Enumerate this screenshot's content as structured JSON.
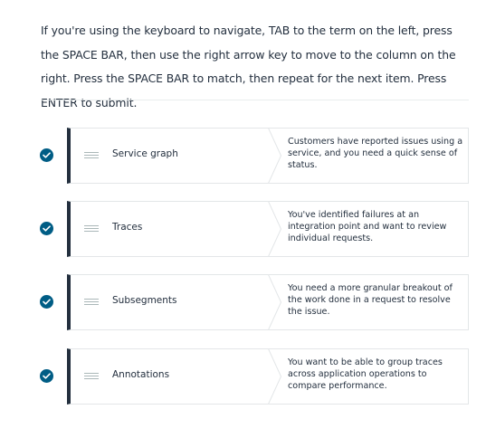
{
  "instructions": "If you're using the keyboard to navigate, TAB to the term on the left, press the SPACE BAR, then use the right arrow key to move to the column on the right. Press the SPACE BAR to match, then repeat for the next item. Press ENTER to submit.",
  "colors": {
    "accent": "#005d85",
    "term_bar": "#232f3e",
    "border": "#e3e6e8",
    "text": "#232f3e"
  },
  "matches": [
    {
      "status_icon": "check-circle-icon",
      "handle_icon": "drag-handle-icon",
      "term": "Service graph",
      "definition": "Customers have reported issues using a service, and you need a quick sense of status."
    },
    {
      "status_icon": "check-circle-icon",
      "handle_icon": "drag-handle-icon",
      "term": "Traces",
      "definition": "You've identified failures at an integration point and want to review individual requests."
    },
    {
      "status_icon": "check-circle-icon",
      "handle_icon": "drag-handle-icon",
      "term": "Subsegments",
      "definition": "You need a more granular breakout of the work done in a request to resolve the issue."
    },
    {
      "status_icon": "check-circle-icon",
      "handle_icon": "drag-handle-icon",
      "term": "Annotations",
      "definition": "You want to be able to group traces across application operations to compare performance."
    }
  ]
}
